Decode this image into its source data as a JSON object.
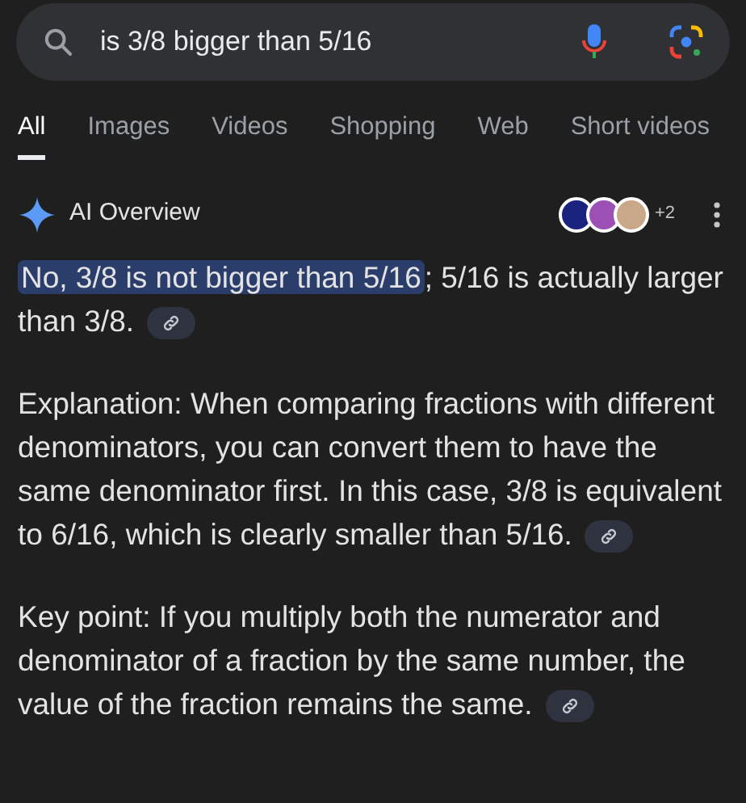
{
  "search": {
    "value": "is 3/8 bigger than 5/16"
  },
  "tabs": [
    {
      "label": "All",
      "selected": true
    },
    {
      "label": "Images",
      "selected": false
    },
    {
      "label": "Videos",
      "selected": false
    },
    {
      "label": "Shopping",
      "selected": false
    },
    {
      "label": "Web",
      "selected": false
    },
    {
      "label": "Short videos",
      "selected": false
    }
  ],
  "overview": {
    "title": "AI Overview",
    "sources_more": "+2",
    "sources": [
      {
        "color": "#1a237e"
      },
      {
        "color": "#9c4fb5"
      },
      {
        "color": "#c9a88a"
      }
    ],
    "paragraphs": [
      {
        "highlight": "No, 3/8 is not bigger than 5/16",
        "text": "; 5/16 is actually larger than 3/8."
      },
      {
        "text": "Explanation: When comparing fractions with different denominators, you can convert them to have the same denominator first. In this case, 3/8 is equivalent to 6/16, which is clearly smaller than 5/16."
      },
      {
        "text": "Key point: If you multiply both the numerator and denominator of a fraction by the same number, the value of the fraction remains the same."
      }
    ]
  }
}
